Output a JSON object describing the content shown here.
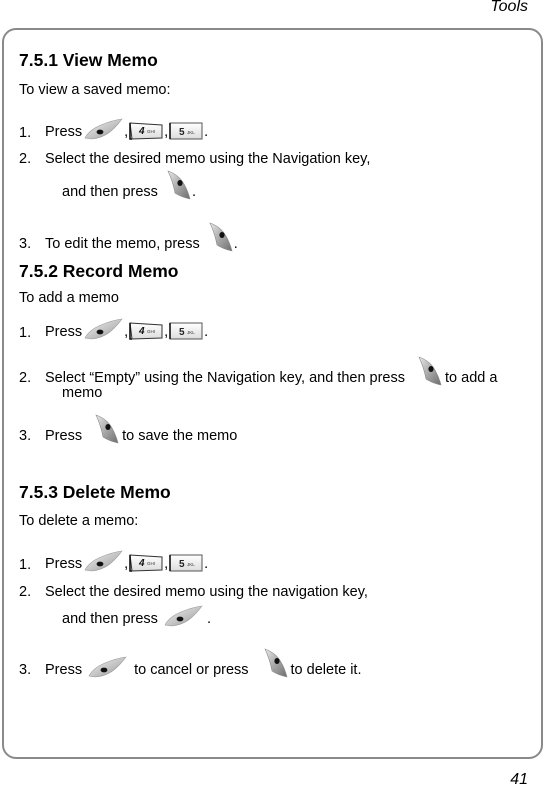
{
  "header": {
    "running_title": "Tools"
  },
  "footer": {
    "page_number": "41"
  },
  "sections": [
    {
      "heading": "7.5.1 View Memo",
      "intro": "To view a saved memo:",
      "steps": [
        {
          "num": "1.",
          "press": "Press",
          "sep1": ",",
          "sep2": ",",
          "end": "."
        },
        {
          "num": "2.",
          "line1": "Select the desired memo using the Navigation key,",
          "line2": "and then press",
          "end": "."
        },
        {
          "num": "3.",
          "text": "To edit the memo, press",
          "end": "."
        }
      ]
    },
    {
      "heading": "7.5.2 Record Memo",
      "intro": "To add a memo",
      "steps": [
        {
          "num": "1.",
          "press": "Press",
          "sep1": ",",
          "sep2": ",",
          "end": "."
        },
        {
          "num": "2.",
          "line1": "Select “Empty” using the Navigation key, and then press",
          "line1_after": "to add a",
          "line2": "memo"
        },
        {
          "num": "3.",
          "press": "Press",
          "after": "to save the memo"
        }
      ]
    },
    {
      "heading": "7.5.3 Delete Memo",
      "intro": "To delete a memo:",
      "steps": [
        {
          "num": "1.",
          "press": "Press",
          "sep1": ",",
          "sep2": ",",
          "end": "."
        },
        {
          "num": "2.",
          "line1": "Select the desired memo using the navigation key,",
          "line2": "and then press",
          "end": "."
        },
        {
          "num": "3.",
          "press": "Press",
          "middle": "to cancel or press",
          "after": "to delete it."
        }
      ]
    }
  ],
  "icons": {
    "left_softkey": "left-soft-key-icon",
    "right_softkey": "right-soft-key-icon",
    "key4": {
      "digit": "4",
      "letters": "GHI"
    },
    "key5": {
      "digit": "5",
      "letters": "JKL"
    }
  },
  "colors": {
    "frame": "#8a8a8a",
    "key_gray": "#b8b8b8",
    "key_dark": "#404040"
  }
}
